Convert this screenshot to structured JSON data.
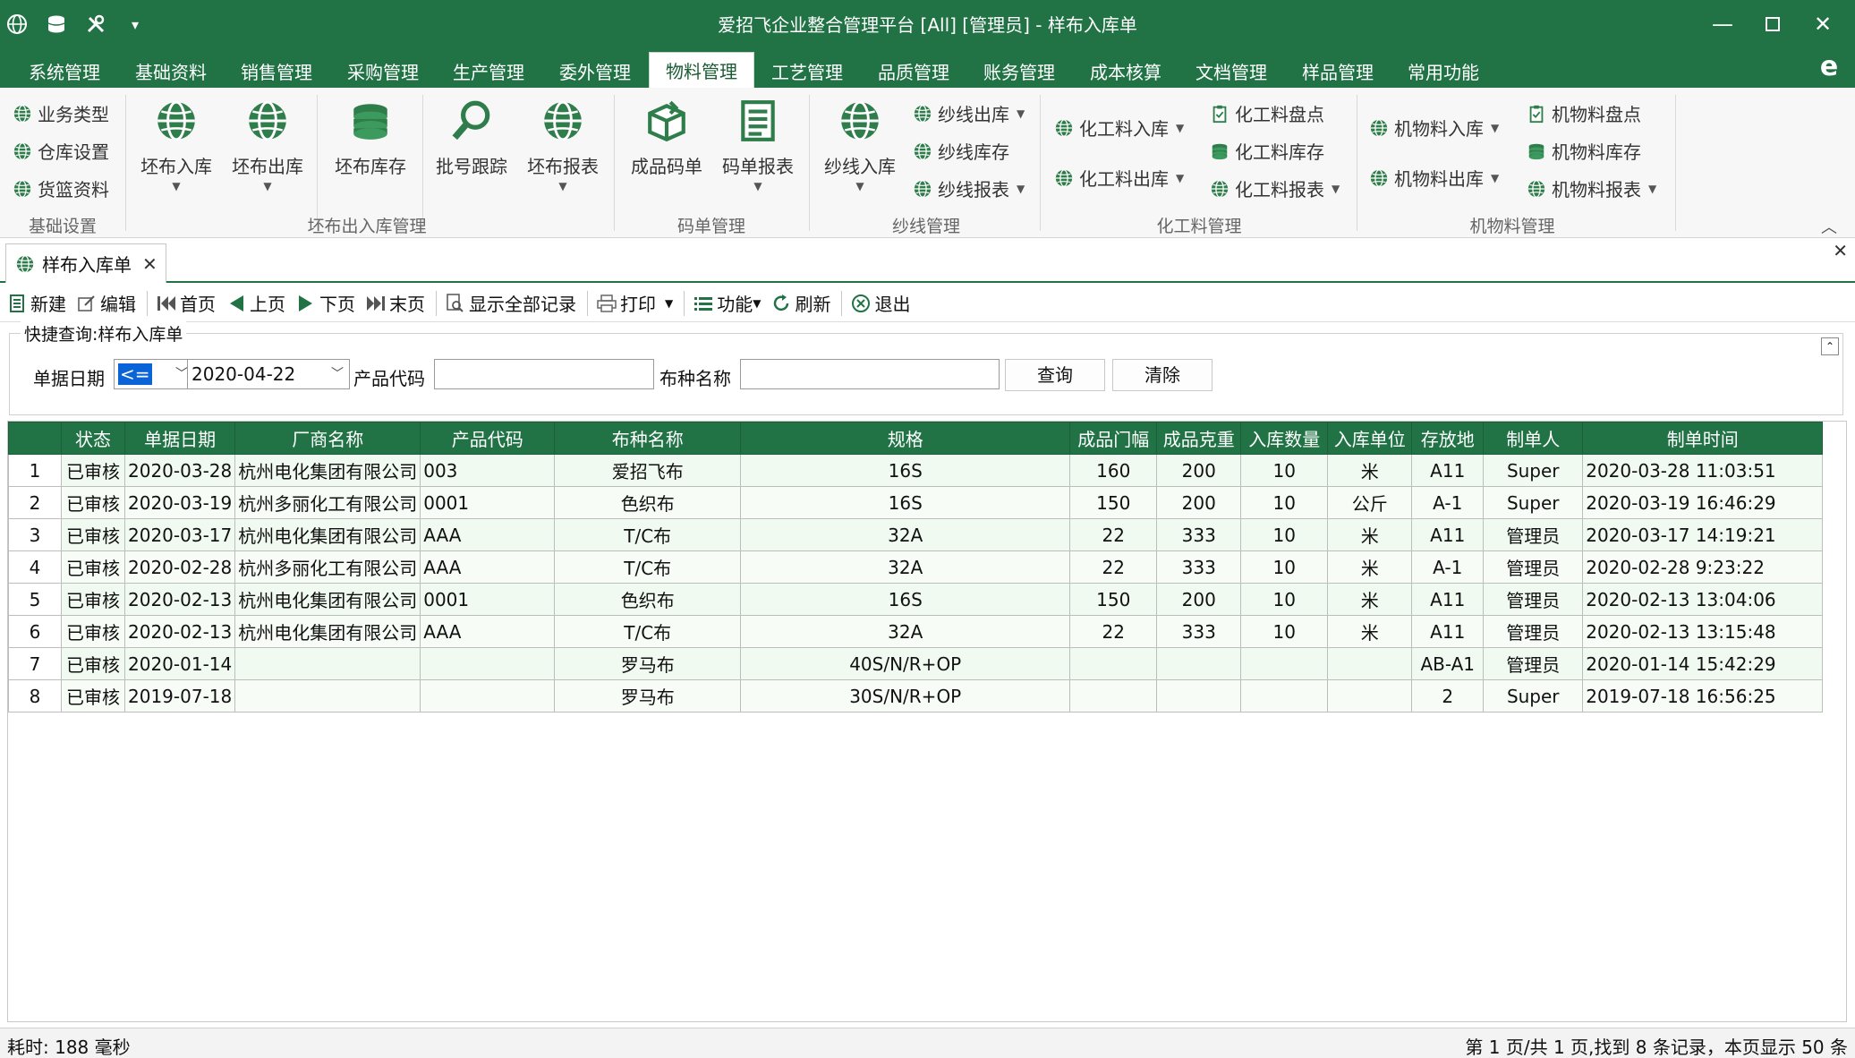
{
  "window": {
    "title": "爱招飞企业整合管理平台 [All] [管理员] - 样布入库单"
  },
  "menu": {
    "tabs": [
      "系统管理",
      "基础资料",
      "销售管理",
      "采购管理",
      "生产管理",
      "委外管理",
      "物料管理",
      "工艺管理",
      "品质管理",
      "账务管理",
      "成本核算",
      "文档管理",
      "样品管理",
      "常用功能"
    ],
    "active": "物料管理"
  },
  "ribbon": {
    "basic": {
      "label": "基础设置",
      "items": [
        "业务类型",
        "仓库设置",
        "货篮资料"
      ]
    },
    "greige": {
      "label": "坯布出入库管理",
      "items": [
        "坯布入库",
        "坯布出库",
        "坯布库存",
        "批号跟踪",
        "坯布报表"
      ]
    },
    "code": {
      "label": "码单管理",
      "items": [
        "成品码单",
        "码单报表"
      ]
    },
    "yarn": {
      "label": "纱线管理",
      "big": "纱线入库",
      "items": [
        "纱线出库",
        "纱线库存",
        "纱线报表"
      ]
    },
    "chem": {
      "label": "化工料管理",
      "items": [
        "化工料入库",
        "化工料出库",
        "化工料盘点",
        "化工料库存",
        "化工料报表"
      ]
    },
    "mach": {
      "label": "机物料管理",
      "items": [
        "机物料入库",
        "机物料出库",
        "机物料盘点",
        "机物料库存",
        "机物料报表"
      ]
    }
  },
  "doc_tab": {
    "label": "样布入库单"
  },
  "toolbar": {
    "new": "新建",
    "edit": "编辑",
    "first": "首页",
    "prev": "上页",
    "next": "下页",
    "last": "末页",
    "show_all": "显示全部记录",
    "print": "打印",
    "func": "功能",
    "refresh": "刷新",
    "exit": "退出"
  },
  "query": {
    "title": "快捷查询:样布入库单",
    "date_label": "单据日期",
    "operator": "<=",
    "date_value": "2020-04-22",
    "product_label": "产品代码",
    "product_value": "",
    "fabric_label": "布种名称",
    "fabric_value": "",
    "search_btn": "查询",
    "clear_btn": "清除"
  },
  "table": {
    "columns": [
      "状态",
      "单据日期",
      "厂商名称",
      "产品代码",
      "布种名称",
      "规格",
      "成品门幅",
      "成品克重",
      "入库数量",
      "入库单位",
      "存放地",
      "制单人",
      "制单时间"
    ],
    "rows": [
      [
        "1",
        "已审核",
        "2020-03-28",
        "杭州电化集团有限公司",
        "003",
        "爱招飞布",
        "16S",
        "160",
        "200",
        "10",
        "米",
        "A11",
        "Super",
        "2020-03-28 11:03:51"
      ],
      [
        "2",
        "已审核",
        "2020-03-19",
        "杭州多丽化工有限公司",
        "0001",
        "色织布",
        "16S",
        "150",
        "200",
        "10",
        "公斤",
        "A-1",
        "Super",
        "2020-03-19 16:46:29"
      ],
      [
        "3",
        "已审核",
        "2020-03-17",
        "杭州电化集团有限公司",
        "AAA",
        "T/C布",
        "32A",
        "22",
        "333",
        "10",
        "米",
        "A11",
        "管理员",
        "2020-03-17 14:19:21"
      ],
      [
        "4",
        "已审核",
        "2020-02-28",
        "杭州多丽化工有限公司",
        "AAA",
        "T/C布",
        "32A",
        "22",
        "333",
        "10",
        "米",
        "A-1",
        "管理员",
        "2020-02-28 9:23:22"
      ],
      [
        "5",
        "已审核",
        "2020-02-13",
        "杭州电化集团有限公司",
        "0001",
        "色织布",
        "16S",
        "150",
        "200",
        "10",
        "米",
        "A11",
        "管理员",
        "2020-02-13 13:04:06"
      ],
      [
        "6",
        "已审核",
        "2020-02-13",
        "杭州电化集团有限公司",
        "AAA",
        "T/C布",
        "32A",
        "22",
        "333",
        "10",
        "米",
        "A11",
        "管理员",
        "2020-02-13 13:15:48"
      ],
      [
        "7",
        "已审核",
        "2020-01-14",
        "",
        "",
        "罗马布",
        "40S/N/R+OP",
        "",
        "",
        "",
        "",
        "AB-A1",
        "管理员",
        "2020-01-14 15:42:29"
      ],
      [
        "8",
        "已审核",
        "2019-07-18",
        "",
        "",
        "罗马布",
        "30S/N/R+OP",
        "",
        "",
        "",
        "",
        "2",
        "Super",
        "2019-07-18 16:56:25"
      ]
    ]
  },
  "status": {
    "left": "耗时: 188 毫秒",
    "right": "第 1 页/共 1 页,找到 8 条记录，本页显示 50 条"
  },
  "colors": {
    "primary": "#217346",
    "row_tint": "#f1faf1"
  },
  "icons": [
    "globe-icon",
    "database-icon",
    "tools-icon",
    "search-icon",
    "coins-icon",
    "box-icon",
    "report-icon"
  ]
}
